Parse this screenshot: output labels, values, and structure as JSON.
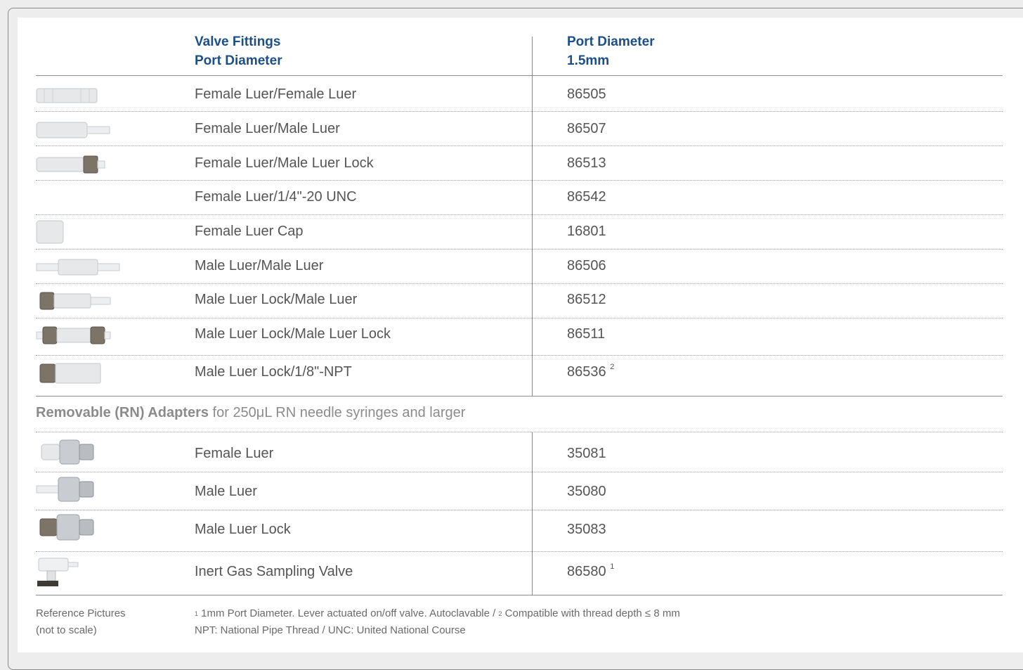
{
  "header": {
    "col1_line1": "Valve Fittings",
    "col1_line2": "Port Diameter",
    "col2_line1": "Port Diameter",
    "col2_line2": "1.5mm"
  },
  "rows": [
    {
      "name": "Female Luer/Female Luer",
      "number": "86505",
      "note": "",
      "icon": "female-female-luer-icon"
    },
    {
      "name": "Female Luer/Male Luer",
      "number": "86507",
      "note": "",
      "icon": "female-male-luer-icon"
    },
    {
      "name": "Female Luer/Male Luer Lock",
      "number": "86513",
      "note": "",
      "icon": "female-male-luer-lock-icon"
    },
    {
      "name": "Female Luer/1/4\"-20 UNC",
      "number": "86542",
      "note": "",
      "icon": ""
    },
    {
      "name": "Female Luer Cap",
      "number": "16801",
      "note": "",
      "icon": "female-luer-cap-icon"
    },
    {
      "name": "Male Luer/Male Luer",
      "number": "86506",
      "note": "",
      "icon": "male-male-luer-icon"
    },
    {
      "name": "Male Luer Lock/Male Luer",
      "number": "86512",
      "note": "",
      "icon": "male-lock-male-luer-icon"
    },
    {
      "name": "Male Luer Lock/Male Luer Lock",
      "number": "86511",
      "note": "",
      "icon": "male-lock-male-lock-icon"
    },
    {
      "name": "Male Luer Lock/1/8\"-NPT",
      "number": "86536",
      "note": "2",
      "icon": "male-lock-npt-icon"
    }
  ],
  "section": {
    "bold": "Removable (RN) Adapters",
    "rest": " for 250μL RN needle syringes and larger"
  },
  "rn_rows": [
    {
      "name": "Female Luer",
      "number": "35081",
      "note": "",
      "icon": "rn-female-luer-icon"
    },
    {
      "name": "Male Luer",
      "number": "35080",
      "note": "",
      "icon": "rn-male-luer-icon"
    },
    {
      "name": "Male Luer Lock",
      "number": "35083",
      "note": "",
      "icon": "rn-male-luer-lock-icon"
    },
    {
      "name": "Inert Gas Sampling Valve",
      "number": "86580",
      "note": "1",
      "icon": "gas-valve-icon"
    }
  ],
  "footer": {
    "ref_line1": "Reference Pictures",
    "ref_line2": "(not to scale)",
    "note1_mark": "1",
    "note1_text": " 1mm Port Diameter. Lever actuated on/off valve. Autoclavable  /  ",
    "note2_mark": "2",
    "note2_text": " Compatible with thread depth ≤ 8 mm",
    "line2": "NPT: National Pipe Thread  /  UNC: United National Course"
  },
  "colors": {
    "header_blue": "#1c4f86",
    "text_gray": "#555555"
  }
}
